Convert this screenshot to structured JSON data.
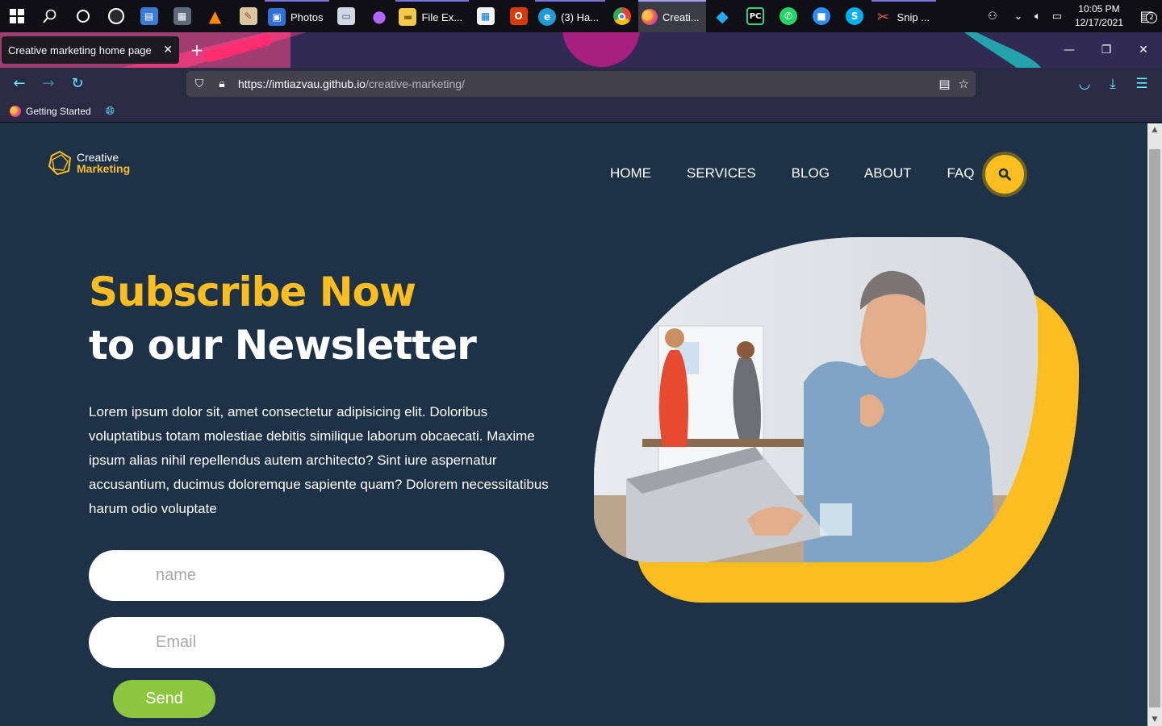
{
  "taskbar": {
    "apps": [
      {
        "id": "photos",
        "label": "Photos",
        "color": "#2f6fd6",
        "glyph": "▣"
      },
      {
        "id": "file-explorer",
        "label": "File Ex...",
        "color": "#f2c94c",
        "glyph": "▬"
      },
      {
        "id": "edge",
        "label": "(3) Ha...",
        "color": "#1f9cd8",
        "glyph": "e"
      },
      {
        "id": "firefox",
        "label": "Creati...",
        "color": "#ff6a36",
        "glyph": "◉"
      },
      {
        "id": "snip",
        "label": "Snip ...",
        "color": "#b03a3a",
        "glyph": "✂"
      }
    ],
    "clock_time": "10:05 PM",
    "clock_date": "12/17/2021",
    "notification_count": "2"
  },
  "browser": {
    "tab_title": "Creative marketing home page",
    "url_host": "https://imtiazvau.github.io",
    "url_path": "/creative-marketing/",
    "bookmark": "Getting Started"
  },
  "site": {
    "logo_line1": "Creative",
    "logo_line2": "Marketing",
    "nav": [
      "HOME",
      "SERVICES",
      "BLOG",
      "ABOUT",
      "FAQ"
    ],
    "headline_yellow": "Subscribe Now",
    "headline_white": "to our Newsletter",
    "body": "Lorem ipsum dolor sit, amet consectetur adipisicing elit. Doloribus voluptatibus totam molestiae debitis similique laborum obcaecati. Maxime ipsum alias nihil repellendus autem architecto? Sint iure aspernatur accusantium, ducimus doloremque sapiente quam? Dolorem necessitatibus harum odio voluptate",
    "name_placeholder": "name",
    "email_placeholder": "Email",
    "send_label": "Send"
  },
  "colors": {
    "page_bg": "#1d3147",
    "accent_yellow": "#fbbd1f",
    "send_green": "#8cc63f",
    "browser_chrome": "#2b2a45"
  }
}
